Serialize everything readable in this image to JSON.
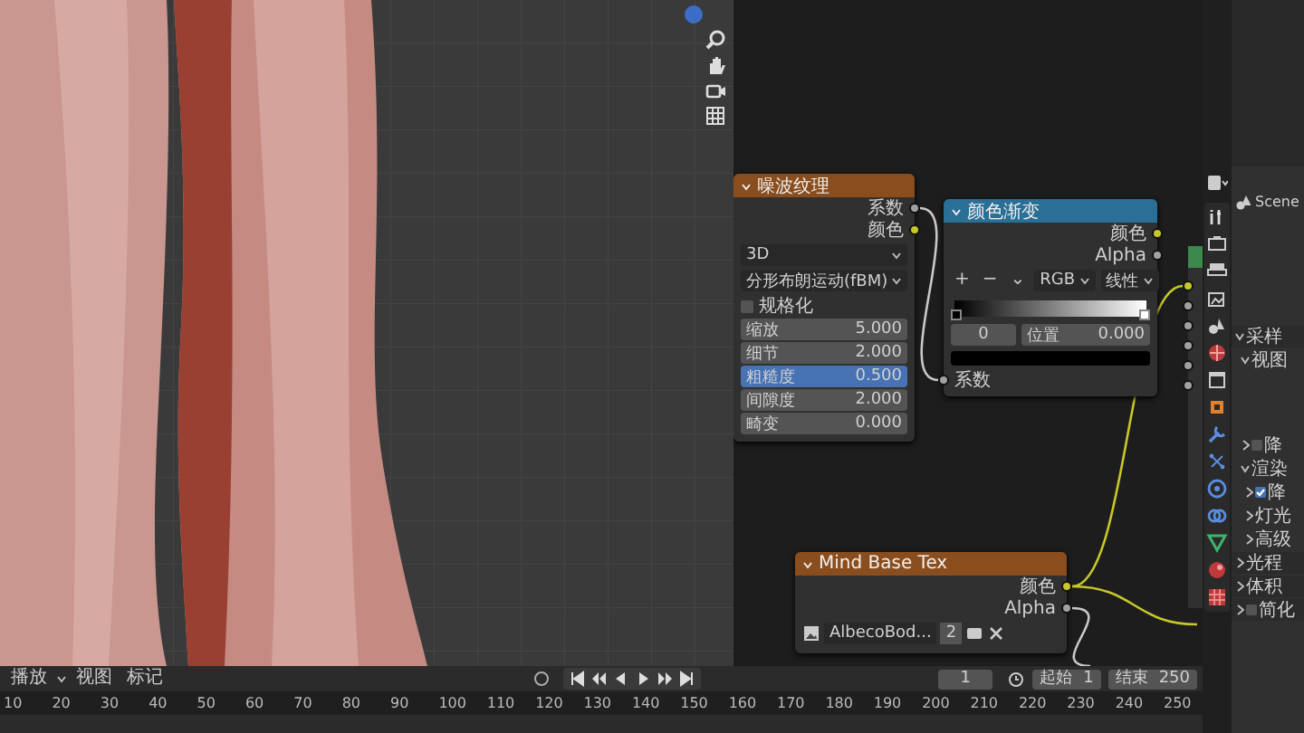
{
  "node_editor": {
    "noise_node": {
      "title": "噪波纹理",
      "outputs": [
        {
          "label": "系数",
          "kind": "float"
        },
        {
          "label": "颜色",
          "kind": "color"
        }
      ],
      "dropdowns": [
        "3D",
        "分形布朗运动(fBM)"
      ],
      "normalize": {
        "label": "规格化",
        "checked": false
      },
      "fields": [
        {
          "label": "缩放",
          "value": "5.000",
          "selected": false
        },
        {
          "label": "细节",
          "value": "2.000",
          "selected": false
        },
        {
          "label": "粗糙度",
          "value": "0.500",
          "selected": true
        },
        {
          "label": "间隙度",
          "value": "2.000",
          "selected": false
        },
        {
          "label": "畸变",
          "value": "0.000",
          "selected": false
        }
      ]
    },
    "ramp_node": {
      "title": "颜色渐变",
      "outputs": [
        {
          "label": "颜色",
          "kind": "color"
        },
        {
          "label": "Alpha",
          "kind": "float"
        }
      ],
      "tools": [
        "+",
        "−",
        "⌄"
      ],
      "mode": "RGB",
      "interpolation": "线性",
      "stop_index": "0",
      "position_label": "位置",
      "position_value": "0.000",
      "input": {
        "label": "系数",
        "kind": "float"
      }
    },
    "image_node": {
      "title": "Mind Base Tex",
      "outputs": [
        {
          "label": "颜色",
          "kind": "color"
        },
        {
          "label": "Alpha",
          "kind": "float"
        }
      ],
      "image": "AlbecoBod...",
      "users": "2"
    }
  },
  "properties": {
    "scene": "Scene",
    "sections": [
      {
        "label": "采样",
        "expanded": true,
        "children": [
          {
            "label": "视图",
            "expanded": true
          },
          {
            "label": "降",
            "expanded": false,
            "checked": false
          },
          {
            "label": "渲染",
            "expanded": true,
            "children": [
              {
                "label": "降",
                "expanded": false,
                "checked": true
              },
              {
                "label": "灯光",
                "expanded": false
              },
              {
                "label": "高级",
                "expanded": false
              }
            ]
          }
        ]
      },
      {
        "label": "光程",
        "expanded": false
      },
      {
        "label": "体积",
        "expanded": false
      },
      {
        "label": "简化",
        "expanded": false,
        "checked": false
      }
    ]
  },
  "timeline": {
    "menus": [
      "播放",
      "视图",
      "标记"
    ],
    "current_frame": "1",
    "start_label": "起始",
    "start": "1",
    "end_label": "结束",
    "end": "250",
    "ticks": [
      "10",
      "20",
      "30",
      "40",
      "50",
      "60",
      "70",
      "80",
      "90",
      "100",
      "110",
      "120",
      "130",
      "140",
      "150",
      "160",
      "170",
      "180",
      "190",
      "200",
      "210",
      "220",
      "230",
      "240",
      "250"
    ]
  }
}
